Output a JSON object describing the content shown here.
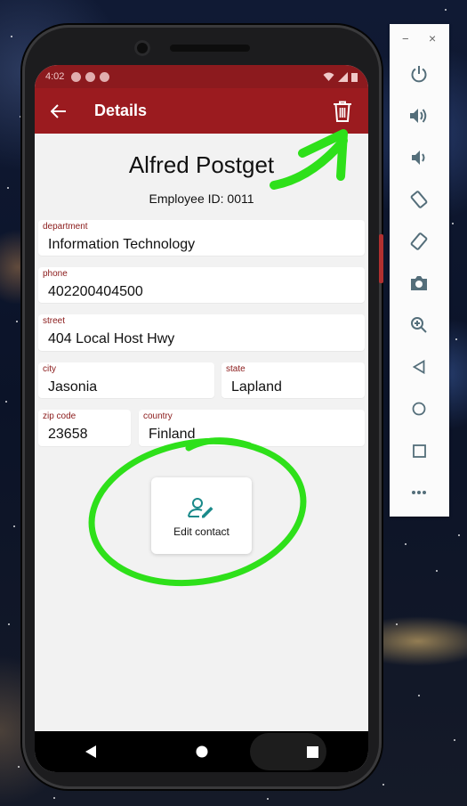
{
  "statusbar": {
    "time": "4:02"
  },
  "appbar": {
    "title": "Details"
  },
  "contact": {
    "name": "Alfred Postget",
    "employee_id": "Employee ID: 0011",
    "fields": {
      "department": {
        "label": "department",
        "value": "Information Technology"
      },
      "phone": {
        "label": "phone",
        "value": "402200404500"
      },
      "street": {
        "label": "street",
        "value": "404 Local Host Hwy"
      },
      "city": {
        "label": "city",
        "value": "Jasonia"
      },
      "state": {
        "label": "state",
        "value": "Lapland"
      },
      "zip": {
        "label": "zip code",
        "value": "23658"
      },
      "country": {
        "label": "country",
        "value": "Finland"
      }
    }
  },
  "edit_button": {
    "label": "Edit contact"
  },
  "toolbar": {
    "minimize": "−",
    "close": "×"
  },
  "icons": {
    "back": "arrow-left-icon",
    "delete": "trash-icon",
    "edit": "person-edit-icon",
    "nav_back": "triangle-back-icon",
    "nav_home": "circle-home-icon",
    "nav_recents": "square-recents-icon",
    "toolbar": [
      "power-icon",
      "volume-up-icon",
      "volume-down-icon",
      "rotate-left-icon",
      "rotate-right-icon",
      "camera-icon",
      "zoom-icon",
      "back-icon",
      "home-icon",
      "overview-icon",
      "more-icon"
    ]
  },
  "colors": {
    "appbar": "#9b1b1f",
    "statusbar": "#8c1a1e",
    "field_label": "#8a1a1a",
    "edit_icon": "#1a8a8a",
    "annotation": "#2ee01a",
    "screen_bg": "#f2f2f2"
  }
}
